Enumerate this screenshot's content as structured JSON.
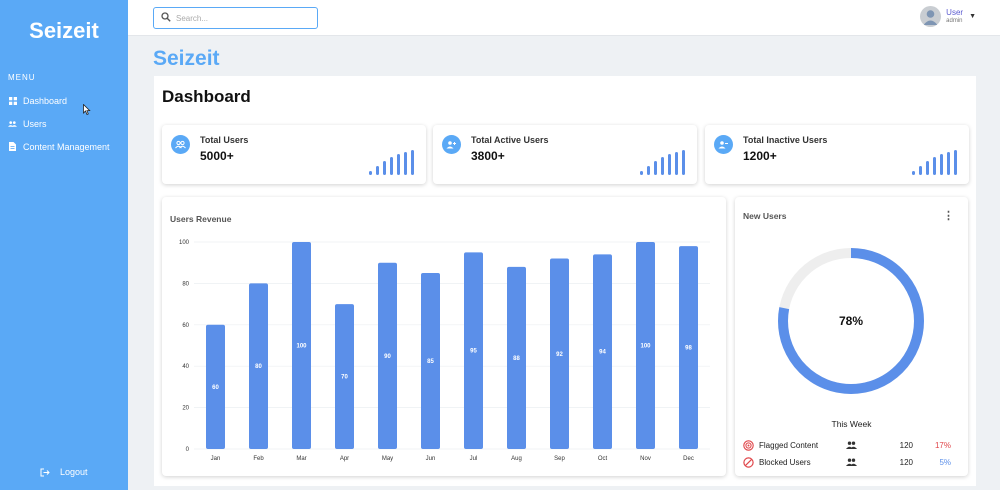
{
  "app": {
    "name": "Seizeit",
    "brand": "Seizeit"
  },
  "sidebar": {
    "menu_label": "MENU",
    "items": [
      {
        "label": "Dashboard",
        "icon": "dashboard-grid-icon"
      },
      {
        "label": "Users",
        "icon": "users-icon"
      },
      {
        "label": "Content Management",
        "icon": "document-icon"
      }
    ],
    "logout_label": "Logout"
  },
  "topbar": {
    "search_placeholder": "Search...",
    "user_name": "User",
    "user_role": "admin"
  },
  "page": {
    "title": "Dashboard"
  },
  "stats": [
    {
      "label": "Total Users",
      "value": "5000+",
      "icon": "users-icon"
    },
    {
      "label": "Total Active Users",
      "value": "3800+",
      "icon": "user-plus-icon"
    },
    {
      "label": "Total Inactive Users",
      "value": "1200+",
      "icon": "user-minus-icon"
    }
  ],
  "chart_data": {
    "type": "bar",
    "title": "Users Revenue",
    "categories": [
      "Jan",
      "Feb",
      "Mar",
      "Apr",
      "May",
      "Jun",
      "Jul",
      "Aug",
      "Sep",
      "Oct",
      "Nov",
      "Dec"
    ],
    "values": [
      60,
      80,
      100,
      70,
      90,
      85,
      95,
      88,
      92,
      94,
      100,
      98
    ],
    "ylim": [
      0,
      100
    ],
    "yticks": [
      0,
      20,
      40,
      60,
      80,
      100
    ],
    "grid": true,
    "data_labels": true,
    "bar_color": "#5b8fe9"
  },
  "new_users": {
    "title": "New Users",
    "percent": 78,
    "percent_label": "78%",
    "period_label": "This Week",
    "ring_color": "#5b8fe9",
    "track_color": "#eeeeee",
    "rows": [
      {
        "label": "Flagged Content",
        "count": "120",
        "pct": "17%",
        "pct_color": "#e0464a",
        "icon": "flag-target-icon",
        "icon_color": "#e0464a"
      },
      {
        "label": "Blocked Users",
        "count": "120",
        "pct": "5%",
        "pct_color": "#5b8fe9",
        "icon": "block-icon",
        "icon_color": "#e0464a"
      }
    ]
  },
  "colors": {
    "sidebar": "#5aa9f6",
    "accent": "#5aa9f6",
    "bar": "#5b8fe9"
  }
}
